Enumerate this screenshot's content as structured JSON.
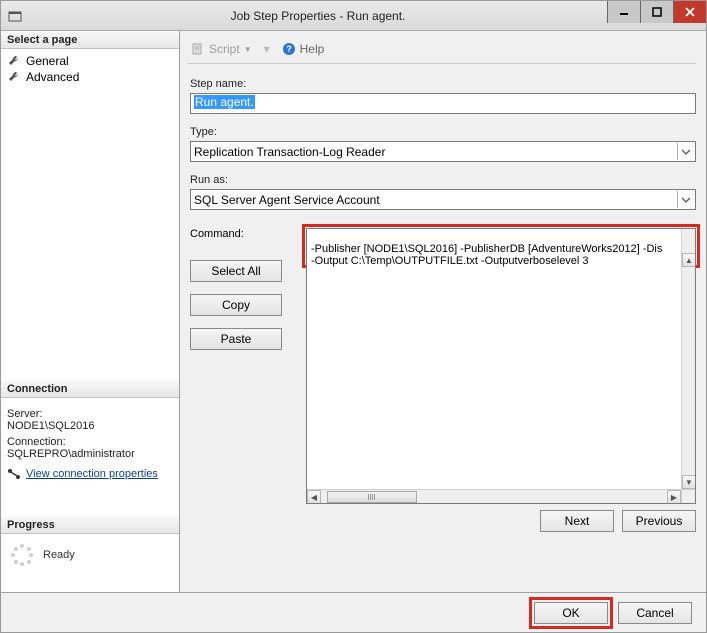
{
  "window": {
    "title": "Job Step Properties - Run agent."
  },
  "left_pane": {
    "select_page_header": "Select a page",
    "nav": {
      "general": "General",
      "advanced": "Advanced"
    },
    "connection_header": "Connection",
    "server_label": "Server:",
    "server_value": "NODE1\\SQL2016",
    "connection_label": "Connection:",
    "connection_value": "SQLREPRO\\administrator",
    "view_conn_link": "View connection properties",
    "progress_header": "Progress",
    "progress_status": "Ready"
  },
  "toolbar": {
    "script_label": "Script",
    "help_label": "Help"
  },
  "form": {
    "step_name_label": "Step name:",
    "step_name_value": "Run agent.",
    "type_label": "Type:",
    "type_value": "Replication Transaction-Log Reader",
    "run_as_label": "Run as:",
    "run_as_value": "SQL Server Agent Service Account",
    "command_label": "Command:",
    "command_text_line1": "-Publisher [NODE1\\SQL2016] -PublisherDB [AdventureWorks2012] -Dis",
    "command_text_line2": "-Output C:\\Temp\\OUTPUTFILE.txt -Outputverboselevel 3",
    "select_all_btn": "Select All",
    "copy_btn": "Copy",
    "paste_btn": "Paste",
    "next_btn": "Next",
    "previous_btn": "Previous"
  },
  "footer": {
    "ok": "OK",
    "cancel": "Cancel"
  }
}
